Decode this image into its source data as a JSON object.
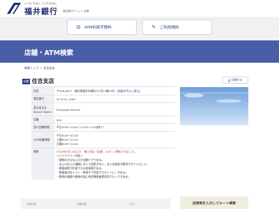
{
  "header": {
    "tagline": "いつも そばに、いつもそばに",
    "logo_text": "福井銀行",
    "sub_text": "福井銀行ホーム ＞ 店舗"
  },
  "quick_buttons": {
    "atm_label": "ATM利用手数料",
    "guide_label": "ご利用規約"
  },
  "page": {
    "title": "店舗・ATM検索"
  },
  "breadcrumb": {
    "items": [
      "検索トップ",
      "住吉支店"
    ],
    "separator": ">"
  },
  "branch": {
    "tag": "店舗",
    "name": "住吉支店",
    "print_label": "印刷する"
  },
  "info": {
    "rows": [
      {
        "label": "住所",
        "value": "〒918-8027　福井県福井市福町3丁目23番39号",
        "link": "[地図の中心に表示]"
      },
      {
        "label": "電話番号",
        "value": "0776-51-1260"
      },
      {
        "label": "英文店名＆Branch Name",
        "value": "Sumiyoshi Branch"
      },
      {
        "label": "店番",
        "value": "204"
      },
      {
        "label": "窓口営業時間",
        "value": "平日9:00～15:00（12/31～1/3は除く）"
      },
      {
        "label": "ATM営業時間",
        "lines": [
          "平日8:00～21:00",
          "土曜8:00～21:00",
          "日曜8:00～21:00"
        ]
      },
      {
        "label": "備考",
        "red_line": "2020年9月14日より、福江支店（店番：200）に移転されました。",
        "lines": [
          "＜バリアフリー内容＞",
          "・建物の主な出入口が自動ドアである。",
          "・出入口および通路において段差がない、または段差が解消されていること。",
          "・障害者等が利用できる駐車場がある。",
          "・障害者対応トイレ（車椅子で利用できるトイレ）がある。",
          "・敷地内通路や建物内部に視覚障害者誘導用ブロックがある。"
        ]
      }
    ]
  },
  "bottom": {
    "left_labels": [
      "店舗外観",
      "店舗内観",
      "ATM"
    ],
    "route_label": "出発地を入力してルート検索"
  },
  "colors": {
    "brand_navy": "#1f2a6b",
    "banner": "#4a5ea8",
    "link": "#1f3f8f",
    "note_red": "#d03030"
  }
}
